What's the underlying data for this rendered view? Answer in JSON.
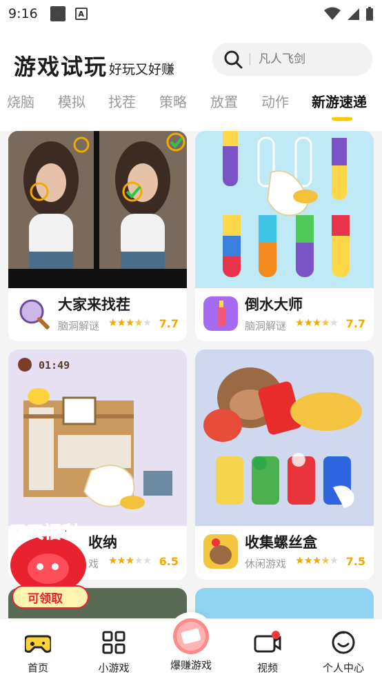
{
  "status_bar": {
    "time": "9:16"
  },
  "header": {
    "title": "游戏试玩",
    "subtitle": "好玩又好赚",
    "search_placeholder": "凡人飞剑"
  },
  "tabs": [
    {
      "label": "烧脑"
    },
    {
      "label": "模拟"
    },
    {
      "label": "找茬"
    },
    {
      "label": "策略"
    },
    {
      "label": "放置"
    },
    {
      "label": "动作"
    },
    {
      "label": "新游速递"
    }
  ],
  "active_tab": "新游速递",
  "games": [
    {
      "name": "大家来找茬",
      "category": "脑洞解谜",
      "score": "7.7",
      "stars": 3.5,
      "icon": "magnifier-icon"
    },
    {
      "name": "倒水大师",
      "category": "脑洞解谜",
      "score": "7.7",
      "stars": 3.5,
      "icon": "water-bottle-icon"
    },
    {
      "name": "收纳",
      "category": "戏",
      "score": "6.5",
      "stars": 3,
      "icon": "storage-icon",
      "thumb_timer": "01:49"
    },
    {
      "name": "收集螺丝盒",
      "category": "休闲游戏",
      "score": "7.5",
      "stars": 3.5,
      "icon": "capybara-icon"
    }
  ],
  "promo": {
    "title": "天天福利",
    "button": "可领取"
  },
  "bottom_nav": [
    {
      "label": "首页",
      "icon": "gamepad-icon"
    },
    {
      "label": "小游戏",
      "icon": "grid-icon"
    },
    {
      "label": "爆赚游戏",
      "icon": "money-icon"
    },
    {
      "label": "视频",
      "icon": "video-icon"
    },
    {
      "label": "个人中心",
      "icon": "smile-icon"
    }
  ],
  "colors": {
    "accent": "#ffc800",
    "star": "#f2a900"
  }
}
